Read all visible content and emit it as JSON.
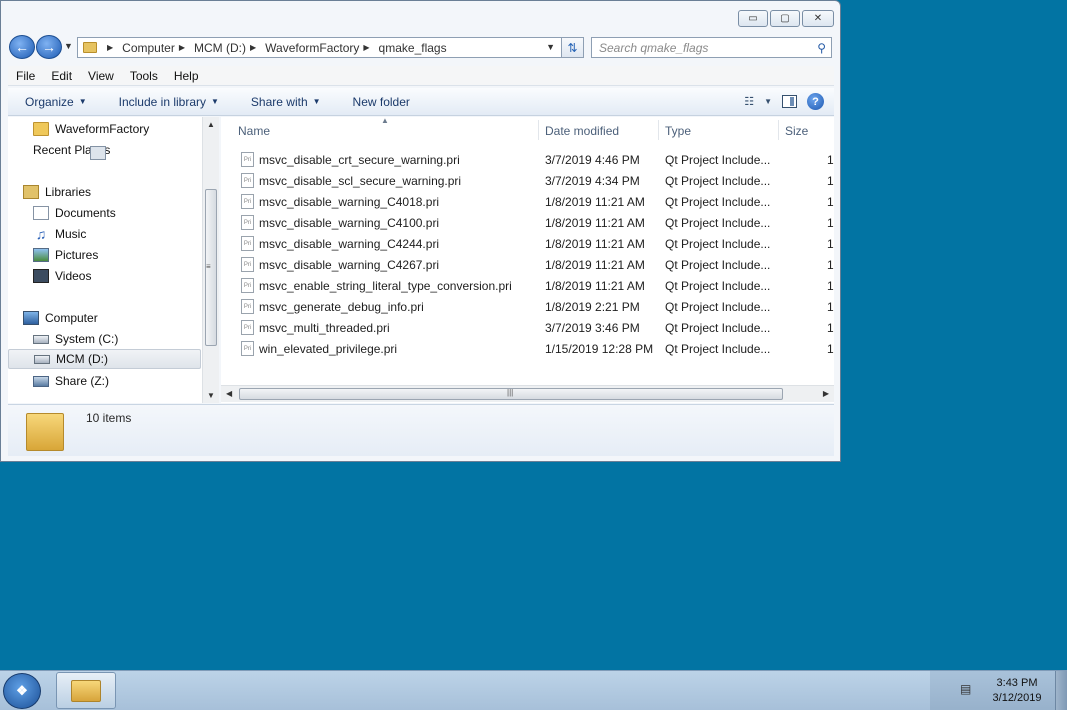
{
  "window": {
    "buttons": {
      "minimize": "▭",
      "maximize": "▢",
      "close": "✕"
    }
  },
  "address": {
    "crumbs": [
      "Computer",
      "MCM (D:)",
      "WaveformFactory",
      "qmake_flags"
    ],
    "search_placeholder": "Search qmake_flags"
  },
  "menu": [
    "File",
    "Edit",
    "View",
    "Tools",
    "Help"
  ],
  "commands": [
    "Organize",
    "Include in library",
    "Share with",
    "New folder"
  ],
  "nav": [
    {
      "label": "WaveformFactory",
      "icon": "folder-icon",
      "selected": false
    },
    {
      "label": "Recent Places",
      "icon": "recent-places-icon",
      "selected": false
    },
    {
      "label": "Libraries",
      "icon": "libraries-icon",
      "selected": false
    },
    {
      "label": "Documents",
      "icon": "documents-icon",
      "selected": false
    },
    {
      "label": "Music",
      "icon": "music-icon",
      "selected": false
    },
    {
      "label": "Pictures",
      "icon": "pictures-icon",
      "selected": false
    },
    {
      "label": "Videos",
      "icon": "videos-icon",
      "selected": false
    },
    {
      "label": "Computer",
      "icon": "computer-icon",
      "selected": false
    },
    {
      "label": "System (C:)",
      "icon": "drive-icon",
      "selected": false
    },
    {
      "label": "MCM (D:)",
      "icon": "drive-icon",
      "selected": true
    },
    {
      "label": "Share (Z:)",
      "icon": "network-drive-icon",
      "selected": false
    }
  ],
  "columns": {
    "name": "Name",
    "date": "Date modified",
    "type": "Type",
    "size": "Size"
  },
  "files": [
    {
      "name": "msvc_disable_crt_secure_warning.pri",
      "date": "3/7/2019 4:46 PM",
      "type": "Qt Project Include...",
      "size": "1"
    },
    {
      "name": "msvc_disable_scl_secure_warning.pri",
      "date": "3/7/2019 4:34 PM",
      "type": "Qt Project Include...",
      "size": "1"
    },
    {
      "name": "msvc_disable_warning_C4018.pri",
      "date": "1/8/2019 11:21 AM",
      "type": "Qt Project Include...",
      "size": "1"
    },
    {
      "name": "msvc_disable_warning_C4100.pri",
      "date": "1/8/2019 11:21 AM",
      "type": "Qt Project Include...",
      "size": "1"
    },
    {
      "name": "msvc_disable_warning_C4244.pri",
      "date": "1/8/2019 11:21 AM",
      "type": "Qt Project Include...",
      "size": "1"
    },
    {
      "name": "msvc_disable_warning_C4267.pri",
      "date": "1/8/2019 11:21 AM",
      "type": "Qt Project Include...",
      "size": "1"
    },
    {
      "name": "msvc_enable_string_literal_type_conversion.pri",
      "date": "1/8/2019 11:21 AM",
      "type": "Qt Project Include...",
      "size": "1"
    },
    {
      "name": "msvc_generate_debug_info.pri",
      "date": "1/8/2019 2:21 PM",
      "type": "Qt Project Include...",
      "size": "1"
    },
    {
      "name": "msvc_multi_threaded.pri",
      "date": "3/7/2019 3:46 PM",
      "type": "Qt Project Include...",
      "size": "1"
    },
    {
      "name": "win_elevated_privilege.pri",
      "date": "1/15/2019 12:28 PM",
      "type": "Qt Project Include...",
      "size": "1"
    }
  ],
  "file_icon_text": "Pri",
  "details": {
    "count": "10 items"
  },
  "taskbar": {
    "time": "3:43 PM",
    "date": "3/12/2019"
  },
  "colors": {
    "desktop": "#0274a3",
    "window": "#f3f6fa",
    "taskbar": "#bcd3e8"
  }
}
